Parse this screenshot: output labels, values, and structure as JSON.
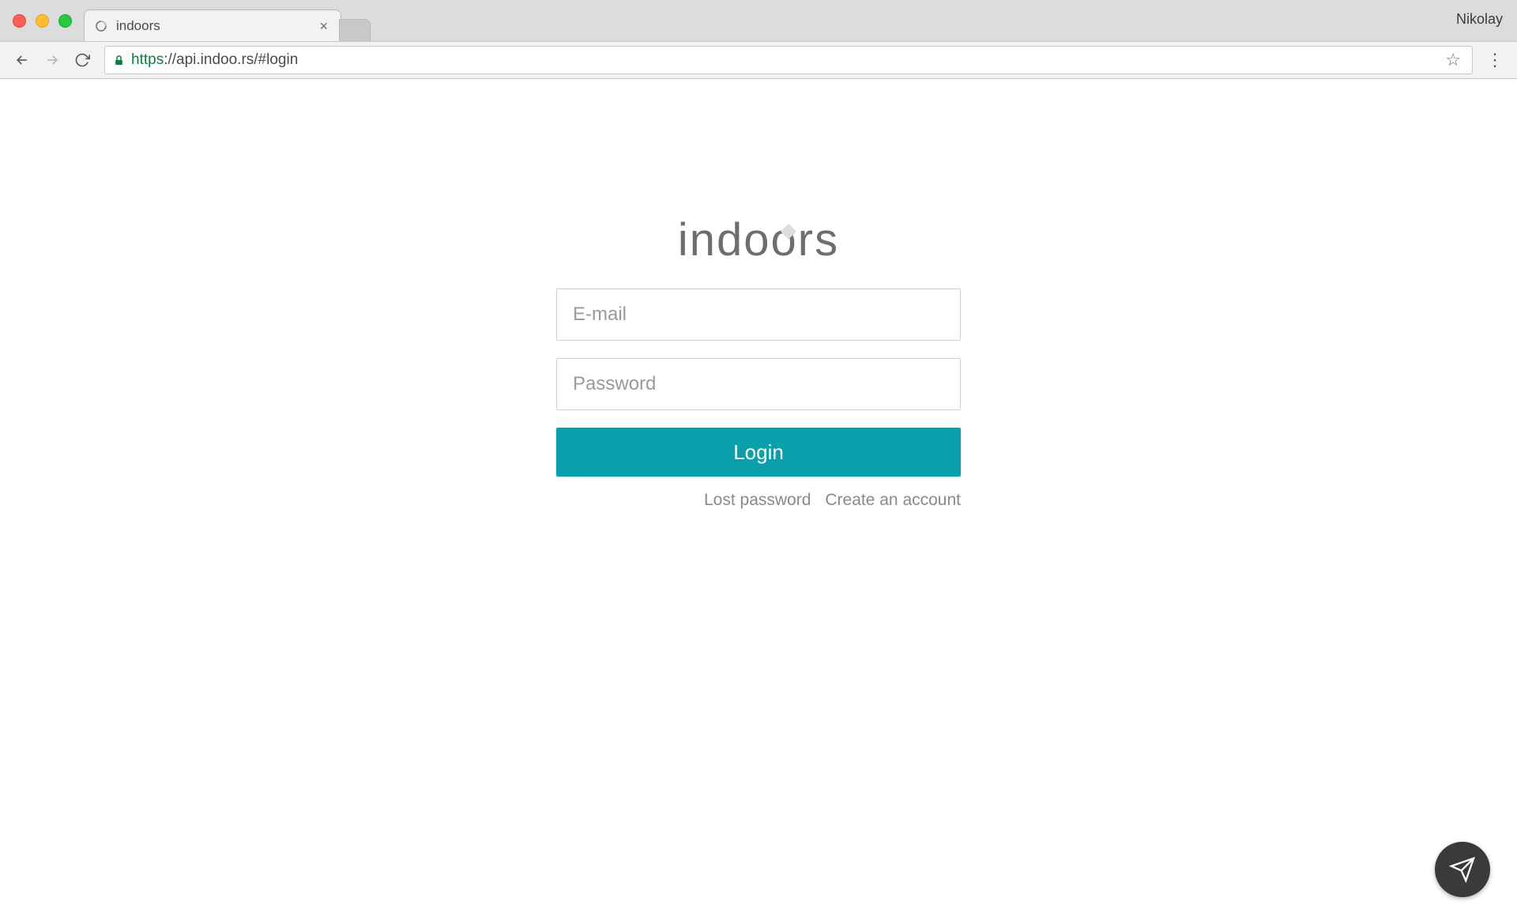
{
  "browser": {
    "profile_name": "Nikolay",
    "tab": {
      "title": "indoors"
    },
    "url_protocol": "https",
    "url_rest": "://api.indoo.rs/#login"
  },
  "page": {
    "logo_text": "indoors",
    "email_placeholder": "E-mail",
    "password_placeholder": "Password",
    "login_label": "Login",
    "lost_password_label": "Lost password",
    "create_account_label": "Create an account"
  },
  "colors": {
    "accent": "#0aa0ab"
  }
}
